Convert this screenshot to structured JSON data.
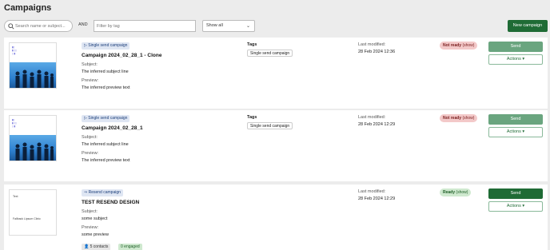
{
  "page": {
    "title": "Campaigns"
  },
  "toolbar": {
    "search_placeholder": "Search name or subject...",
    "and_label": "AND",
    "tag_placeholder": "Filter by tag",
    "show_filter": "Show all",
    "new_campaign_label": "New campaign"
  },
  "campaigns": [
    {
      "type": "Single send campaign",
      "name": "Campaign 2024_02_28_1 - Clone",
      "subject_label": "Subject:",
      "subject": "The inferred subject line",
      "preview_label": "Preview:",
      "preview": "The inferred preview text",
      "tags_label": "Tags",
      "tag": "Single send campaign",
      "modified_label": "Last modified:",
      "modified": "28 Feb 2024 12:36",
      "status": "Not ready",
      "status_hint": "(show)",
      "send_label": "Send",
      "actions_label": "Actions ▾"
    },
    {
      "type": "Single send campaign",
      "name": "Campaign 2024_02_28_1",
      "subject_label": "Subject:",
      "subject": "The inferred subject line",
      "preview_label": "Preview:",
      "preview": "The inferred preview text",
      "tags_label": "Tags",
      "tag": "Single send campaign",
      "modified_label": "Last modified:",
      "modified": "28 Feb 2024 12:29",
      "status": "Not ready",
      "status_hint": "(show)",
      "send_label": "Send",
      "actions_label": "Actions ▾"
    },
    {
      "type": "Resend campaign",
      "name": "TEST RESEND DESIGN",
      "subject_label": "Subject:",
      "subject": "some subject",
      "preview_label": "Preview:",
      "preview": "some preview",
      "modified_label": "Last modified:",
      "modified": "28 Feb 2024 12:29",
      "status": "Ready",
      "status_hint": "(show)",
      "send_label": "Send",
      "actions_label": "Actions ▾",
      "contacts": "5 contacts",
      "engaged": "0 engaged",
      "thumb_text_1": "Text",
      "thumb_text_2": "Fallback Lipsum Clinic"
    }
  ],
  "icons": {
    "search": "search-icon",
    "chevron": "chevron-down-icon",
    "single_send": "play-outline-icon",
    "resend": "resend-icon",
    "contacts": "person-icon"
  }
}
